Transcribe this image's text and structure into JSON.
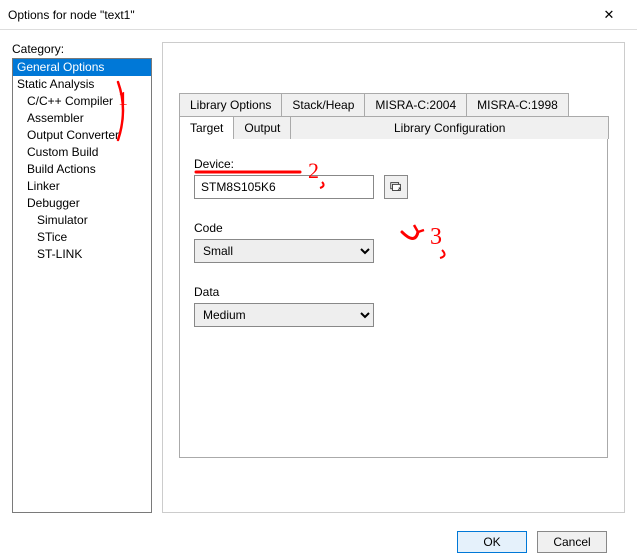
{
  "window": {
    "title": "Options for node \"text1\"",
    "close": "✕"
  },
  "category": {
    "label": "Category:",
    "items": [
      {
        "label": "General Options",
        "indent": 0,
        "selected": true
      },
      {
        "label": "Static Analysis",
        "indent": 0
      },
      {
        "label": "C/C++ Compiler",
        "indent": 1
      },
      {
        "label": "Assembler",
        "indent": 1
      },
      {
        "label": "Output Converter",
        "indent": 1
      },
      {
        "label": "Custom Build",
        "indent": 1
      },
      {
        "label": "Build Actions",
        "indent": 1
      },
      {
        "label": "Linker",
        "indent": 1
      },
      {
        "label": "Debugger",
        "indent": 1
      },
      {
        "label": "Simulator",
        "indent": 2
      },
      {
        "label": "STice",
        "indent": 2
      },
      {
        "label": "ST-LINK",
        "indent": 2
      }
    ]
  },
  "tabs": {
    "row1": [
      {
        "label": "Library Options"
      },
      {
        "label": "Stack/Heap"
      },
      {
        "label": "MISRA-C:2004"
      },
      {
        "label": "MISRA-C:1998"
      }
    ],
    "row2": [
      {
        "label": "Target",
        "active": true
      },
      {
        "label": "Output"
      },
      {
        "label": "Library Configuration",
        "wide": true
      }
    ]
  },
  "target": {
    "device_label": "Device:",
    "device_value": "STM8S105K6",
    "code_label": "Code",
    "code_value": "Small",
    "data_label": "Data",
    "data_value": "Medium"
  },
  "buttons": {
    "ok": "OK",
    "cancel": "Cancel"
  },
  "annotations": {
    "one": "1",
    "two": "2",
    "three": "3"
  },
  "colors": {
    "selection": "#0078d7",
    "annotation": "#ff0000"
  }
}
